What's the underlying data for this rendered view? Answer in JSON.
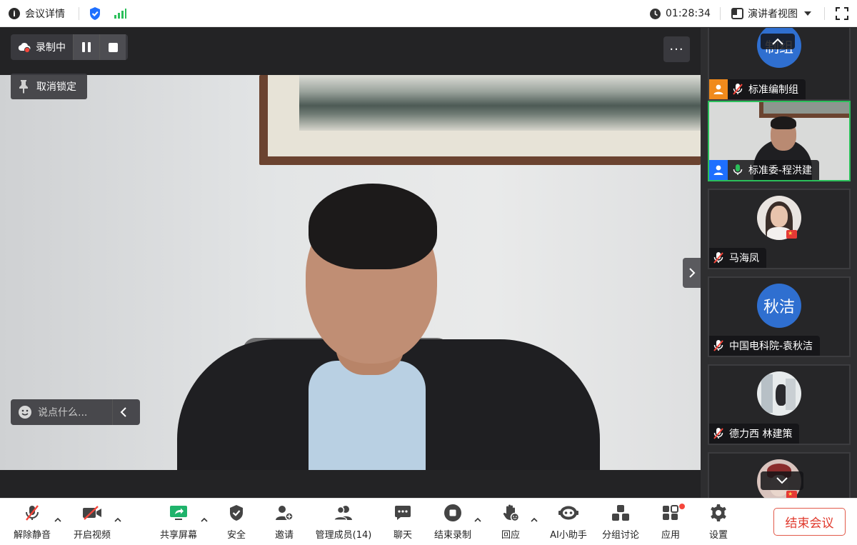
{
  "topbar": {
    "meeting_details": "会议详情",
    "timer": "01:28:34",
    "view_mode": "演讲者视图"
  },
  "stage": {
    "recording_label": "录制中",
    "unpin_label": "取消锁定",
    "chat_placeholder": "说点什么...",
    "more_label": "···"
  },
  "participants": [
    {
      "name": "标准编制组",
      "avatar_text": "制组",
      "avatar_color": "#2f6fd0",
      "muted": true,
      "role": "host"
    },
    {
      "name": "标准委-程洪建",
      "video": true,
      "muted": false,
      "role": "cohost",
      "active_speaker": true
    },
    {
      "name": "马海凤",
      "muted": true,
      "has_photo": true
    },
    {
      "name": "中国电科院-袁秋洁",
      "avatar_text": "秋洁",
      "avatar_color": "#2f6fd0",
      "muted": true
    },
    {
      "name": "德力西 林建策",
      "muted": true,
      "has_photo": true
    },
    {
      "name": "",
      "has_photo": true
    }
  ],
  "toolbar": {
    "unmute": "解除静音",
    "start_video": "开启视频",
    "share_screen": "共享屏幕",
    "security": "安全",
    "invite": "邀请",
    "manage_members": "管理成员(14)",
    "chat": "聊天",
    "end_recording": "结束录制",
    "reactions": "回应",
    "ai_assistant": "AI小助手",
    "breakout": "分组讨论",
    "apps": "应用",
    "settings": "设置",
    "end_meeting": "结束会议"
  },
  "colors": {
    "accent_green": "#2bbf5a",
    "end_red": "#e0382b",
    "brand_blue": "#1e6fff"
  }
}
